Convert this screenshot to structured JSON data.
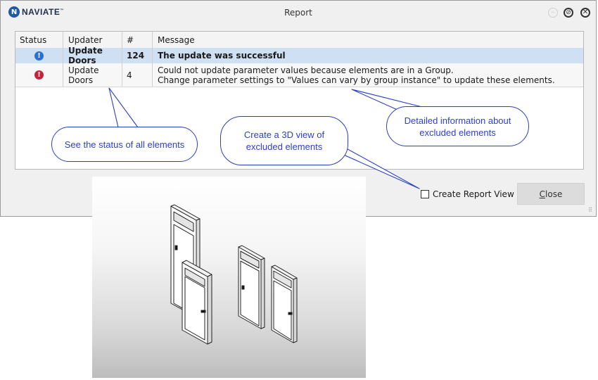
{
  "window": {
    "brand": "NAVIATE",
    "brand_mark": "N",
    "title": "Report"
  },
  "table": {
    "columns": [
      "Status",
      "Updater",
      "#",
      "Message"
    ],
    "rows": [
      {
        "status_icon": "info-icon",
        "updater": "Update Doors",
        "count": "124",
        "message_line1": "The update was successful",
        "message_line2": "",
        "selected": true
      },
      {
        "status_icon": "error-icon",
        "updater": "Update Doors",
        "count": "4",
        "message_line1": "Could not update parameter values because elements are in a Group.",
        "message_line2": "Change parameter settings to \"Values can vary by group instance\" to update these elements.",
        "selected": false
      }
    ]
  },
  "footer": {
    "checkbox_label": "Create Report View",
    "checkbox_checked": false,
    "close_label_first": "C",
    "close_label_rest": "lose"
  },
  "annotations": {
    "status": "See the status of all elements",
    "view": "Create a 3D view of excluded elements",
    "details": "Detailed information about excluded elements"
  },
  "colors": {
    "accent_blue": "#2c3fd0",
    "selected_row": "#cfe0f3",
    "info": "#2d6fd0",
    "error": "#c6223b"
  }
}
